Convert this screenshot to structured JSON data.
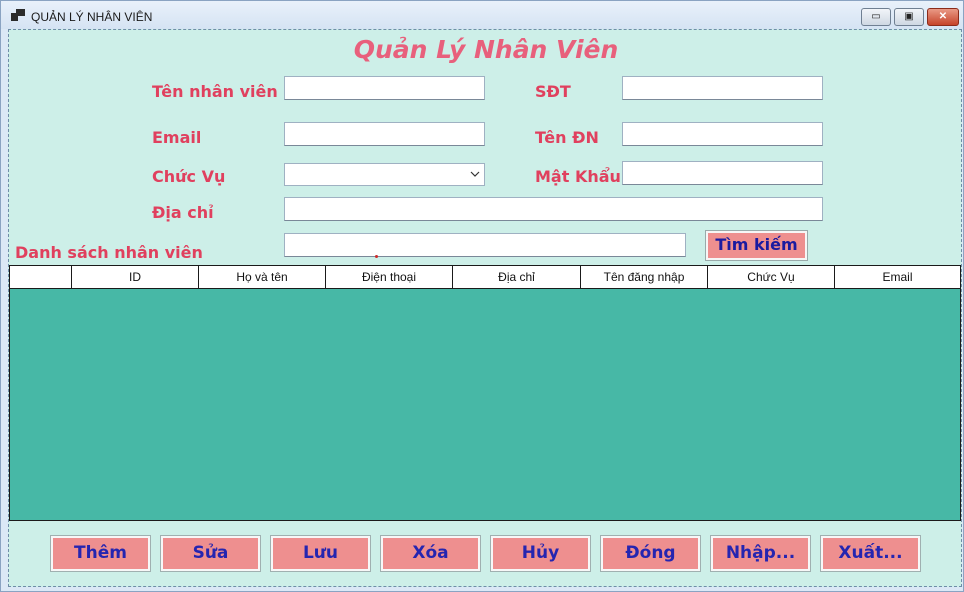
{
  "window": {
    "title": "QUẢN LÝ NHÂN VIÊN",
    "controls": {
      "minimize": "▭",
      "maximize": "▣",
      "close": "✕"
    }
  },
  "form": {
    "heading": "Quản Lý Nhân Viên",
    "labels": {
      "name": "Tên nhân viên",
      "phone": "SĐT",
      "email": "Email",
      "username": "Tên ĐN",
      "position": "Chức Vụ",
      "password": "Mật Khẩu",
      "address": "Địa chỉ",
      "list": "Danh sách nhân viên"
    },
    "values": {
      "name": "",
      "phone": "",
      "email": "",
      "username": "",
      "position": "",
      "password": "",
      "address": "",
      "search": ""
    },
    "search_button": "Tìm kiếm"
  },
  "grid": {
    "columns": [
      "",
      "ID",
      "Họ và tên",
      "Điện thoại",
      "Địa chỉ",
      "Tên đăng nhập",
      "Chức Vụ",
      "Email"
    ],
    "rows": []
  },
  "actions": [
    "Thêm",
    "Sửa",
    "Lưu",
    "Xóa",
    "Hủy",
    "Đóng",
    "Nhập...",
    "Xuất..."
  ],
  "colors": {
    "client_bg": "#cdefe8",
    "grid_bg": "#47b8a6",
    "label": "#e0405e",
    "button_bg": "#ee8f8f",
    "button_text": "#2525b0"
  },
  "icons": {
    "app": "window-app-icon",
    "dropdown": "chevron-down-icon"
  }
}
